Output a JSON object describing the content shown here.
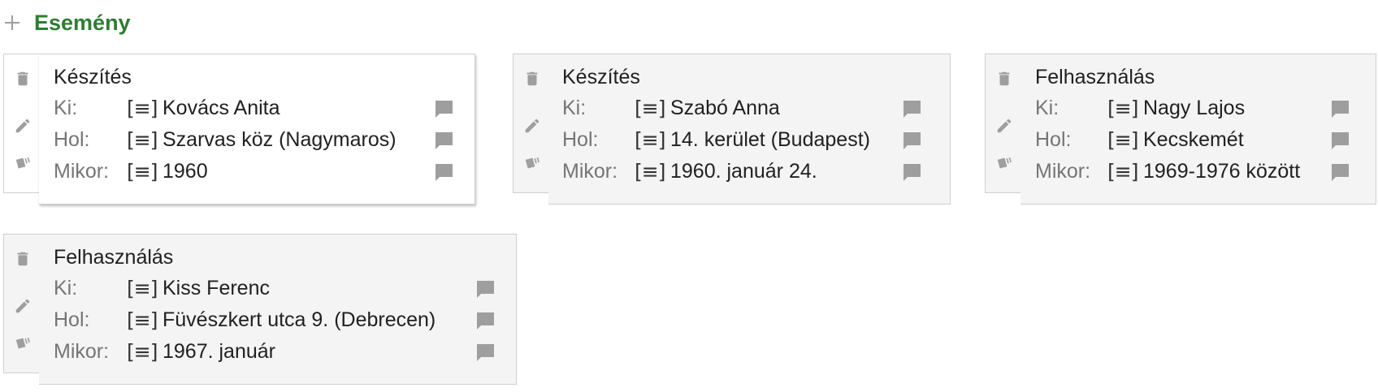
{
  "section": {
    "title": "Esemény",
    "icon": "plus-icon"
  },
  "doc_glyph": "[≡]",
  "cards": [
    {
      "title": "Készítés",
      "rows": [
        {
          "label": "Ki:",
          "value": "Kovács Anita"
        },
        {
          "label": "Hol:",
          "value": "Szarvas köz (Nagymaros)"
        },
        {
          "label": "Mikor:",
          "value": "1960"
        }
      ]
    },
    {
      "title": "Készítés",
      "rows": [
        {
          "label": "Ki:",
          "value": "Szabó Anna"
        },
        {
          "label": "Hol:",
          "value": "14. kerület (Budapest)"
        },
        {
          "label": "Mikor:",
          "value": "1960. január 24."
        }
      ]
    },
    {
      "title": "Felhasználás",
      "rows": [
        {
          "label": "Ki:",
          "value": "Nagy Lajos"
        },
        {
          "label": "Hol:",
          "value": "Kecskemét"
        },
        {
          "label": "Mikor:",
          "value": "1969-1976 között"
        }
      ]
    },
    {
      "title": "Felhasználás",
      "rows": [
        {
          "label": "Ki:",
          "value": "Kiss Ferenc"
        },
        {
          "label": "Hol:",
          "value": "Füvészkert utca 9. (Debrecen)"
        },
        {
          "label": "Mikor:",
          "value": "1967. január"
        }
      ]
    }
  ],
  "colors": {
    "accent": "#2e7d32",
    "icon": "#9e9e9e",
    "card_border": "#cfcfcf",
    "card_grey": "#f4f4f4"
  }
}
